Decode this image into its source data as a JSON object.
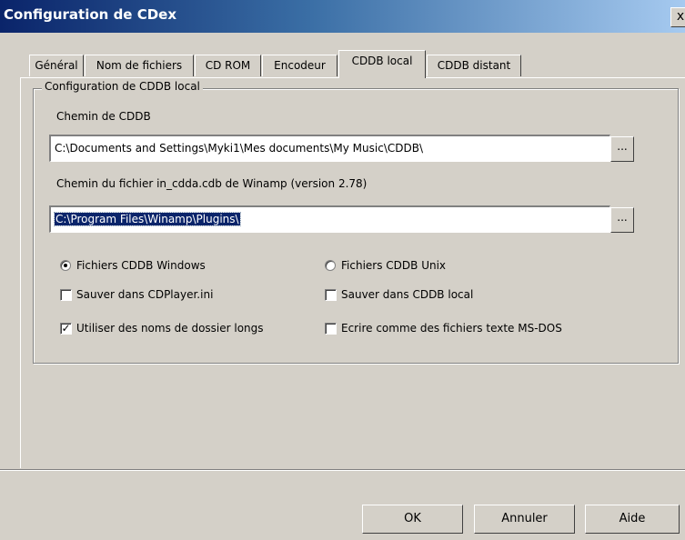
{
  "window": {
    "title": "Configuration de CDex",
    "close_label": "x"
  },
  "tabs": [
    {
      "label": "Général"
    },
    {
      "label": "Nom de fichiers"
    },
    {
      "label": "CD ROM"
    },
    {
      "label": "Encodeur"
    },
    {
      "label": "CDDB local",
      "active": true
    },
    {
      "label": "CDDB distant"
    }
  ],
  "group": {
    "title": "Configuration de CDDB local",
    "cddb_path_label": "Chemin de CDDB",
    "cddb_path_value": "C:\\Documents and Settings\\Myki1\\Mes documents\\My Music\\CDDB\\",
    "winamp_path_label": "Chemin du fichier in_cdda.cdb de Winamp (version 2.78)",
    "winamp_path_value": "C:\\Program Files\\Winamp\\Plugins\\",
    "browse_label": "...",
    "radio_windows": {
      "label": "Fichiers CDDB Windows",
      "selected": true
    },
    "radio_unix": {
      "label": "Fichiers CDDB Unix",
      "selected": false
    },
    "check_cdplayer": {
      "label": "Sauver dans CDPlayer.ini",
      "checked": false
    },
    "check_local": {
      "label": "Sauver dans CDDB local",
      "checked": false
    },
    "check_long_names": {
      "label": "Utiliser des noms de dossier longs",
      "checked": true
    },
    "check_msdos": {
      "label": "Ecrire comme des fichiers texte MS-DOS",
      "checked": false
    },
    "check_mark": "✓"
  },
  "buttons": {
    "ok": "OK",
    "cancel": "Annuler",
    "help": "Aide"
  }
}
